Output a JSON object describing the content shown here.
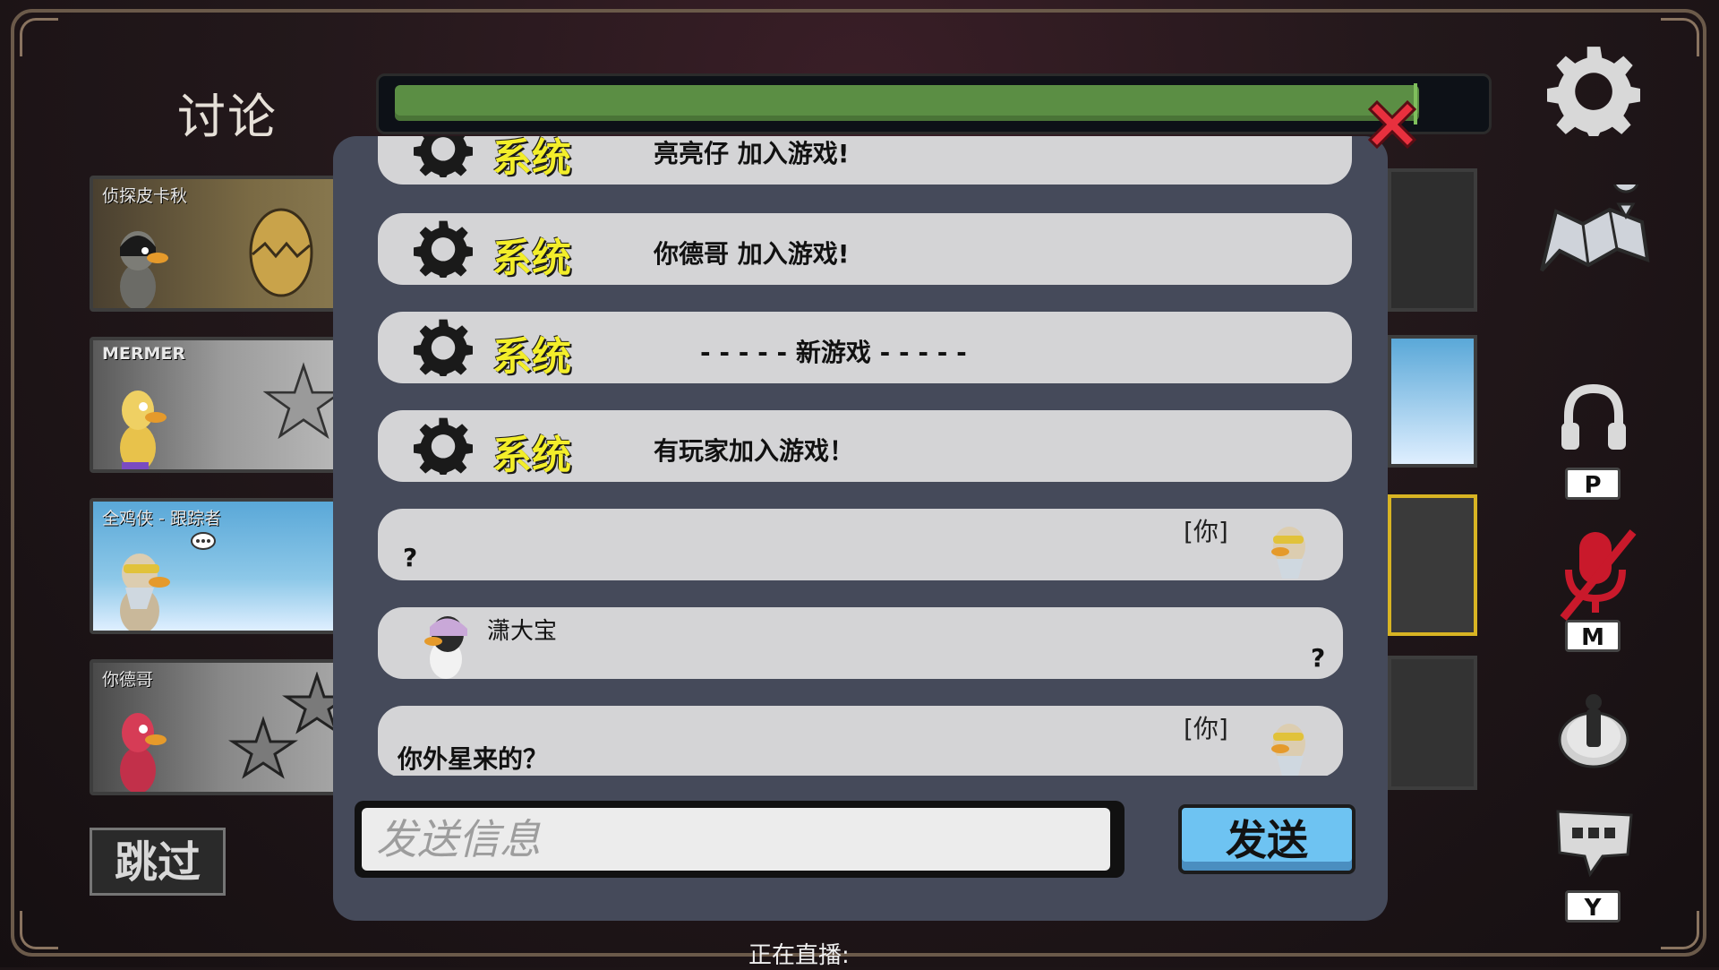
{
  "screen": {
    "title": "讨论",
    "timer_progress": 0.95
  },
  "players": [
    {
      "name": "侦探皮卡秋"
    },
    {
      "name": "MERMER"
    },
    {
      "name": "全鸡侠 - 跟踪者"
    },
    {
      "name": "你德哥"
    }
  ],
  "skip_label": "跳过",
  "chat": {
    "messages": [
      {
        "type": "system",
        "sender": "系统",
        "text": "亮亮仔 加入游戏!"
      },
      {
        "type": "system",
        "sender": "系统",
        "text": "你德哥 加入游戏!"
      },
      {
        "type": "system",
        "sender": "系统",
        "text": "- - - - - 新游戏 - - - - -"
      },
      {
        "type": "system",
        "sender": "系统",
        "text": "有玩家加入游戏！"
      },
      {
        "type": "self",
        "tag": "[你]",
        "text": "?"
      },
      {
        "type": "other",
        "sender": "潇大宝",
        "text": "?"
      },
      {
        "type": "self",
        "tag": "[你]",
        "text": "你外星来的？"
      }
    ],
    "input_placeholder": "发送信息",
    "send_label": "发送"
  },
  "live_text": "正在直播:",
  "side_controls": {
    "settings": "gear-icon",
    "map": "map-icon",
    "voice_key": "P",
    "mic_key": "M",
    "emote_key": "Y"
  },
  "colors": {
    "timer_green": "#5b8e44",
    "system_label_yellow": "#f3ee2a",
    "send_blue": "#6ec3f2",
    "close_red": "#e8303e",
    "highlight_yellow": "#d8b423",
    "mute_red": "#c9192b"
  }
}
